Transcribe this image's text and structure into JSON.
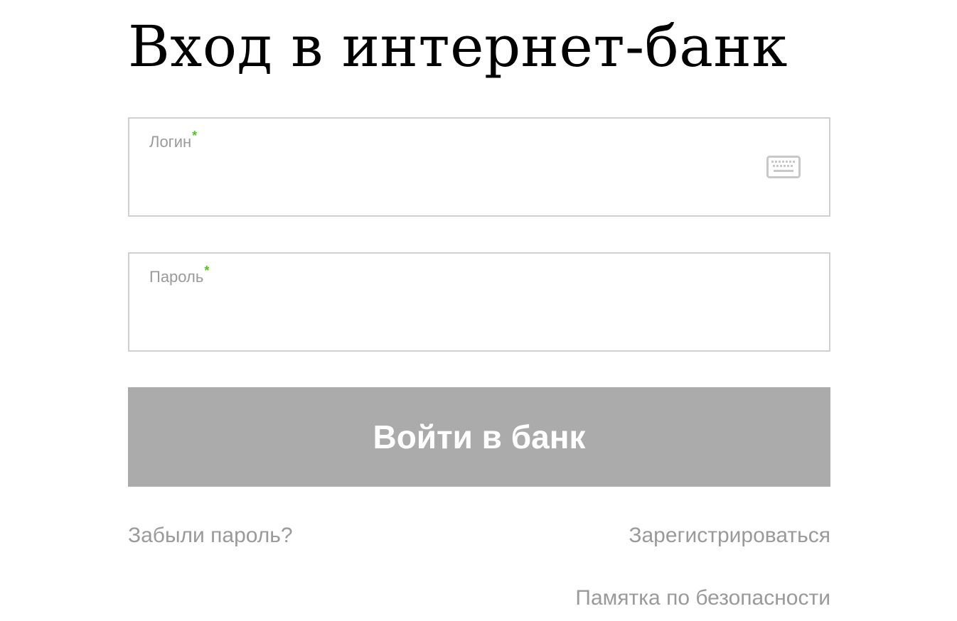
{
  "page": {
    "title": "Вход в интернет-банк"
  },
  "form": {
    "login": {
      "label": "Логин",
      "required_mark": "*",
      "value": "",
      "keyboard_icon": "virtual-keyboard-icon"
    },
    "password": {
      "label": "Пароль",
      "required_mark": "*",
      "value": ""
    },
    "submit_label": "Войти в банк"
  },
  "links": {
    "forgot_password": "Забыли пароль?",
    "register": "Зарегистрироваться",
    "security_memo": "Памятка по безопасности"
  },
  "colors": {
    "required_mark": "#58c322",
    "button_background": "#ababab",
    "link_text": "#9a9a9a",
    "field_border": "#d0d0d0"
  }
}
